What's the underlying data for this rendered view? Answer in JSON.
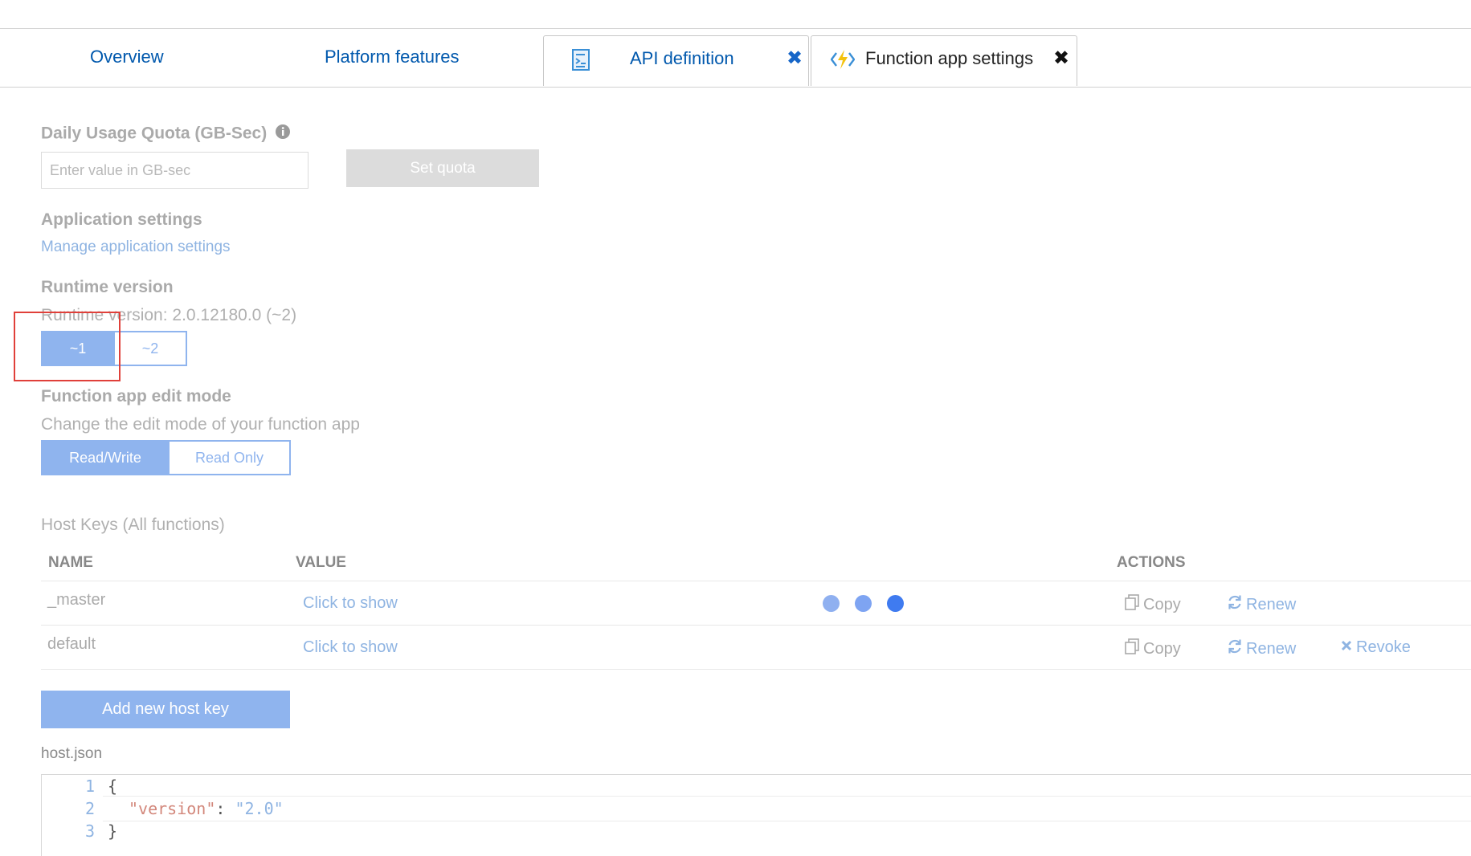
{
  "tabs": {
    "overview": "Overview",
    "platform_features": "Platform features",
    "api_definition": "API definition",
    "function_app_settings": "Function app settings",
    "close_glyph": "✖"
  },
  "quota": {
    "label": "Daily Usage Quota (GB-Sec)",
    "placeholder": "Enter value in GB-sec",
    "button": "Set quota"
  },
  "app_settings": {
    "label": "Application settings",
    "link": "Manage application settings"
  },
  "runtime": {
    "label": "Runtime version",
    "current": "Runtime version: 2.0.12180.0 (~2)",
    "options": [
      "~1",
      "~2"
    ],
    "selected": "~1"
  },
  "edit_mode": {
    "label": "Function app edit mode",
    "description": "Change the edit mode of your function app",
    "options": [
      "Read/Write",
      "Read Only"
    ],
    "selected": "Read/Write"
  },
  "host_keys": {
    "title": "Host Keys (All functions)",
    "columns": [
      "NAME",
      "VALUE",
      "ACTIONS"
    ],
    "rows": [
      {
        "name": "_master",
        "value": "Click to show",
        "copy": "Copy",
        "renew": "Renew",
        "revoke": ""
      },
      {
        "name": "default",
        "value": "Click to show",
        "copy": "Copy",
        "renew": "Renew",
        "revoke": "Revoke"
      }
    ],
    "add_button": "Add new host key"
  },
  "host_json": {
    "label": "host.json",
    "line_numbers": [
      "1",
      "2",
      "3"
    ],
    "lines": {
      "open": "{",
      "key": "\"version\"",
      "colon": ": ",
      "value": "\"2.0\"",
      "close": "}"
    }
  },
  "colors": {
    "link": "#0058ad",
    "accent": "#8fb4ee",
    "loading_dots": [
      "#8fb0f0",
      "#7ea4f2",
      "#3f7bf0"
    ],
    "highlight_box": "#e0403a"
  },
  "icons": {
    "api_definition": "api-document-icon",
    "function_app_settings": "function-bolt-icon",
    "info": "info-icon",
    "copy": "copy-icon",
    "renew": "refresh-icon",
    "revoke": "close-icon"
  }
}
